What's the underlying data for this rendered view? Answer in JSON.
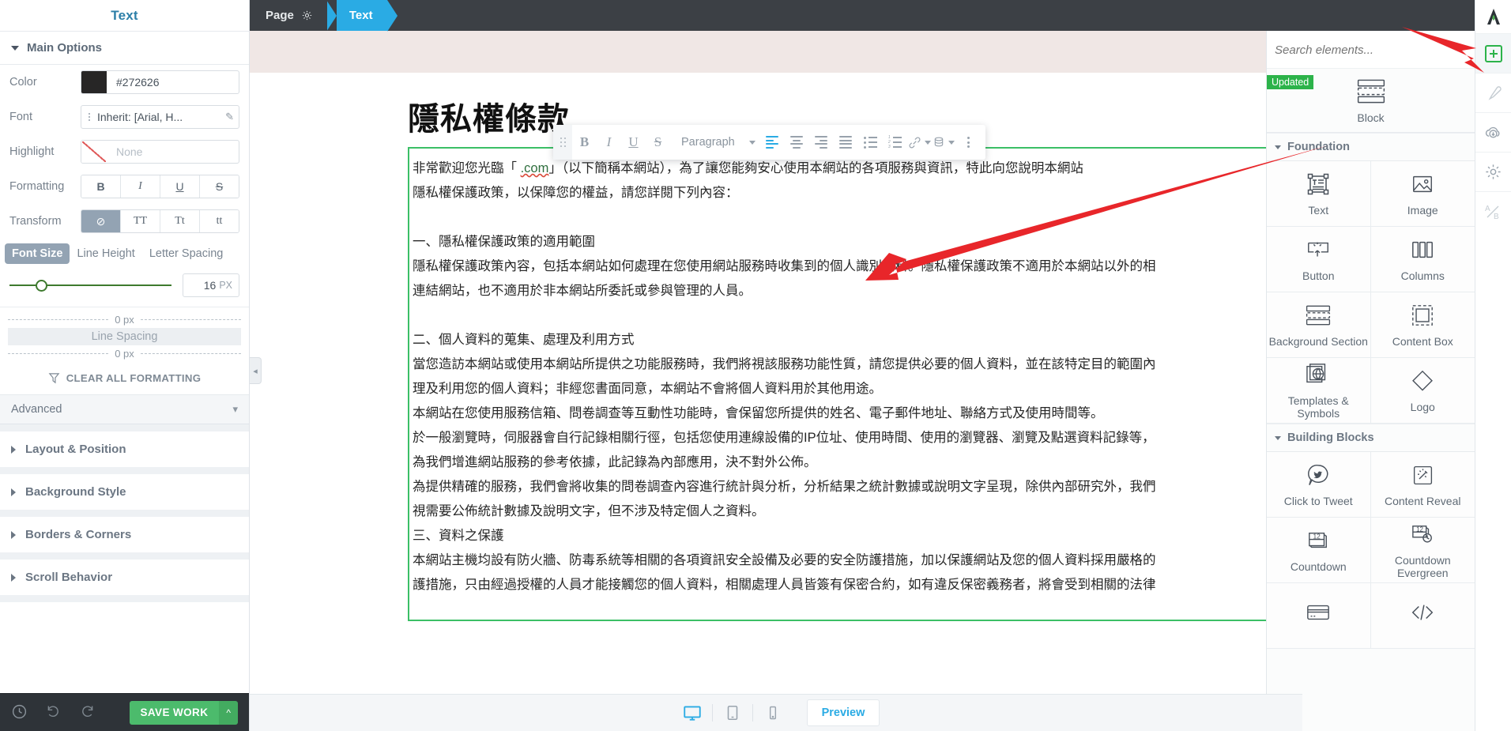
{
  "sidebar": {
    "title": "Text",
    "main_options": "Main Options",
    "labels": {
      "color": "Color",
      "font": "Font",
      "highlight": "Highlight",
      "formatting": "Formatting",
      "transform": "Transform"
    },
    "color_value": "#272626",
    "color_swatch": "#272626",
    "font_value": "Inherit: [Arial, H...",
    "highlight_value": "None",
    "formatting_buttons": [
      "B",
      "I",
      "U",
      "S"
    ],
    "transform_buttons": [
      "⊘",
      "TT",
      "Tt",
      "tt"
    ],
    "size_tabs": [
      "Font Size",
      "Line Height",
      "Letter Spacing"
    ],
    "size_tab_active": "Font Size",
    "font_size_value": "16",
    "font_size_unit": "PX",
    "spacing_top": "0 px",
    "spacing_label": "Line Spacing",
    "spacing_bottom": "0 px",
    "clear_all_formatting": "CLEAR ALL FORMATTING",
    "advanced": "Advanced",
    "sections": [
      "Layout & Position",
      "Background Style",
      "Borders & Corners",
      "Scroll Behavior"
    ],
    "footer": {
      "save_label": "SAVE WORK",
      "history_icon": "clock-history-icon",
      "undo_icon": "undo-icon",
      "redo_icon": "redo-icon",
      "save_caret": "^"
    }
  },
  "topbar": {
    "page_label": "Page",
    "page_gear_icon": "gear-icon",
    "text_label": "Text"
  },
  "toolbar": {
    "grip_icon": "drag-grip-icon",
    "bold": "B",
    "italic": "I",
    "underline": "U",
    "strike": "S",
    "paragraph_label": "Paragraph",
    "align_left_icon": "align-left-icon",
    "align_center_icon": "align-center-icon",
    "align_right_icon": "align-right-icon",
    "align_justify_icon": "align-justify-icon",
    "bullet_list_icon": "bullet-list-icon",
    "numbered_list_icon": "numbered-list-icon",
    "link_icon": "link-icon",
    "database_icon": "database-icon",
    "more_icon": "kebab-more-icon"
  },
  "document": {
    "title": "隱私權條款",
    "lines": [
      "非常歡迎您光臨「              .com」（以下簡稱本網站），為了讓您能夠安心使用本網站的各項服務與資訊，特此向您說明本網站",
      "隱私權保護政策，以保障您的權益，請您詳閱下列內容：",
      "",
      "一、隱私權保護政策的適用範圍",
      "隱私權保護政策內容，包括本網站如何處理在您使用網站服務時收集到的個人識別資料。隱私權保護政策不適用於本網站以外的相",
      "連結網站，也不適用於非本網站所委託或參與管理的人員。",
      "",
      "二、個人資料的蒐集、處理及利用方式",
      "當您造訪本網站或使用本網站所提供之功能服務時，我們將視該服務功能性質，請您提供必要的個人資料，並在該特定目的範圍內",
      "理及利用您的個人資料；非經您書面同意，本網站不會將個人資料用於其他用途。",
      "本網站在您使用服務信箱、問卷調查等互動性功能時，會保留您所提供的姓名、電子郵件地址、聯絡方式及使用時間等。",
      "於一般瀏覽時，伺服器會自行記錄相關行徑，包括您使用連線設備的IP位址、使用時間、使用的瀏覽器、瀏覽及點選資料記錄等，",
      "為我們增進網站服務的參考依據，此記錄為內部應用，決不對外公佈。",
      "為提供精確的服務，我們會將收集的問卷調查內容進行統計與分析，分析結果之統計數據或說明文字呈現，除供內部研究外，我們",
      "視需要公佈統計數據及說明文字，但不涉及特定個人之資料。",
      "三、資料之保護",
      "本網站主機均設有防火牆、防毒系統等相關的各項資訊安全設備及必要的安全防護措施，加以保護網站及您的個人資料採用嚴格的",
      "護措施，只由經過授權的人員才能接觸您的個人資料，相關處理人員皆簽有保密合約，如有違反保密義務者，將會受到相關的法律"
    ],
    "link_text": ".com",
    "element_bar_icons": [
      "move-icon",
      "save-icon",
      "duplicate-icon"
    ]
  },
  "bottombar": {
    "desktop_icon": "desktop-icon",
    "tablet_icon": "tablet-icon",
    "mobile_icon": "mobile-icon",
    "preview_label": "Preview"
  },
  "elements_panel": {
    "search_placeholder": "Search elements...",
    "block": {
      "badge": "Updated",
      "label": "Block",
      "icon": "block-icon"
    },
    "groups": [
      {
        "title": "Foundation",
        "items": [
          {
            "label": "Text",
            "icon": "text-element-icon"
          },
          {
            "label": "Image",
            "icon": "image-icon"
          },
          {
            "label": "Button",
            "icon": "button-icon"
          },
          {
            "label": "Columns",
            "icon": "columns-icon"
          },
          {
            "label": "Background Section",
            "icon": "background-section-icon"
          },
          {
            "label": "Content Box",
            "icon": "content-box-icon"
          },
          {
            "label": "Templates & Symbols",
            "icon": "templates-symbols-icon"
          },
          {
            "label": "Logo",
            "icon": "logo-icon"
          }
        ]
      },
      {
        "title": "Building Blocks",
        "items": [
          {
            "label": "Click to Tweet",
            "icon": "twitter-icon"
          },
          {
            "label": "Content Reveal",
            "icon": "content-reveal-icon"
          },
          {
            "label": "Countdown",
            "icon": "countdown-icon"
          },
          {
            "label": "Countdown Evergreen",
            "icon": "countdown-evergreen-icon"
          },
          {
            "label": "",
            "icon": "card-icon"
          },
          {
            "label": "",
            "icon": "code-icon"
          }
        ]
      }
    ]
  },
  "rail": {
    "logo_icon": "thrive-logo-icon",
    "icons": [
      "add-element-icon",
      "brush-icon",
      "cloud-download-icon",
      "gear-icon",
      "ab-test-icon"
    ]
  },
  "colors": {
    "accent_blue": "#2aabe4",
    "green": "#2cb34a",
    "save_green": "#4cbb6c",
    "dark_topbar": "#3c4045",
    "arrow_red": "#e8262a"
  }
}
